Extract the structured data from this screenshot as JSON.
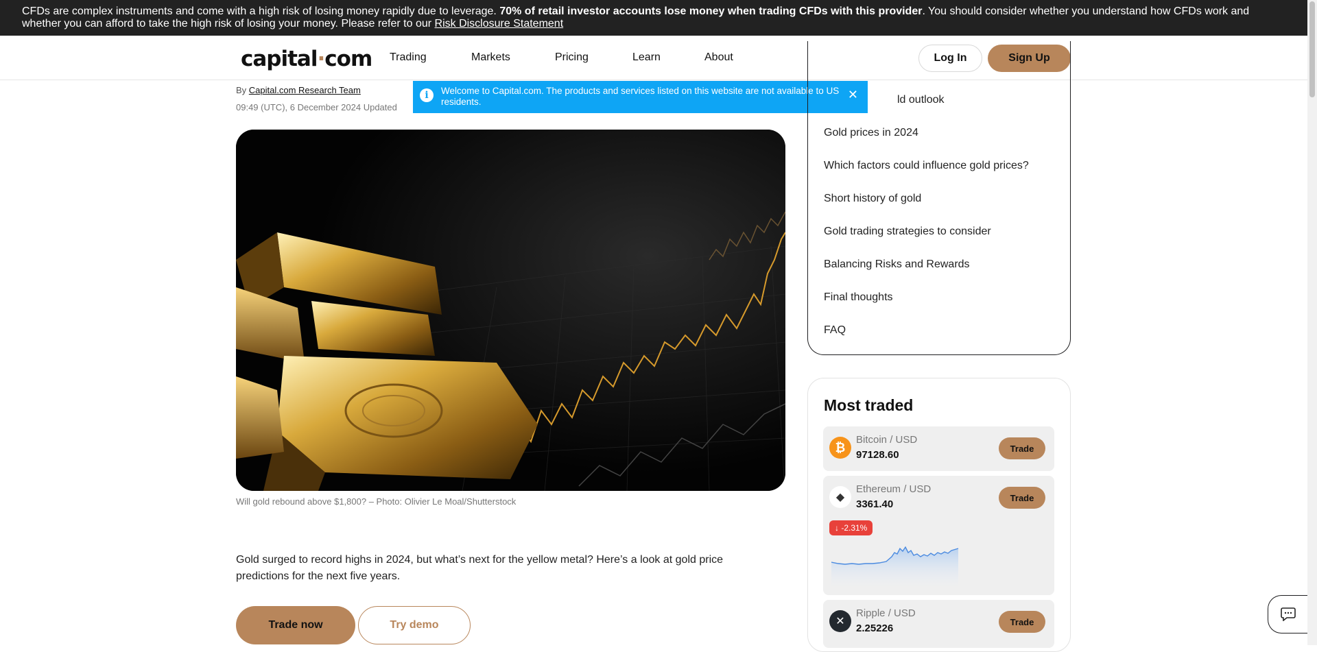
{
  "risk_banner": {
    "text_before": "CFDs are complex instruments and come with a high risk of losing money rapidly due to leverage. ",
    "bold": "70% of retail investor accounts lose money when trading CFDs with this provider",
    "text_after": ". You should consider whether you understand how CFDs work and whether you can afford to take the high risk of losing your money. Please refer to our ",
    "link": "Risk Disclosure Statement"
  },
  "header": {
    "logo_left": "capital",
    "logo_dot": "·",
    "logo_right": "com",
    "nav": [
      "Trading",
      "Markets",
      "Pricing",
      "Learn",
      "About"
    ],
    "login": "Log In",
    "signup": "Sign Up"
  },
  "toast": {
    "icon": "info-icon",
    "text": "Welcome to Capital.com. The products and services listed on this website are not available to US residents.",
    "close": "✕"
  },
  "article": {
    "by": "By ",
    "author": "Capital.com Research Team",
    "date": "09:49 (UTC), 6 December 2024 Updated",
    "caption": "Will gold rebound above $1,800? – Photo: Olivier Le Moal/Shutterstock",
    "intro": "Gold surged to record highs in 2024, but what’s next for the yellow metal? Here’s a look at gold price predictions for the next five years.",
    "trade_now": "Trade now",
    "try_demo": "Try demo"
  },
  "toc": {
    "items": [
      "ld outlook",
      "Gold prices in 2024",
      "Which factors could influence gold prices?",
      "Short history of gold",
      "Gold trading strategies to consider",
      "Balancing Risks and Rewards",
      "Final thoughts",
      "FAQ"
    ]
  },
  "most_traded": {
    "title": "Most traded",
    "trade_label": "Trade",
    "items": [
      {
        "name": "Bitcoin / USD",
        "price": "97128.60",
        "icon": "bitcoin-icon",
        "color": "#f7931a",
        "glyph": "₿"
      },
      {
        "name": "Ethereum / USD",
        "price": "3361.40",
        "icon": "ethereum-icon",
        "color": "#ffffff",
        "glyph": "◆",
        "change": "↓ -2.31%"
      },
      {
        "name": "Ripple / USD",
        "price": "2.25226",
        "icon": "ripple-icon",
        "color": "#23292f",
        "glyph": "✕"
      }
    ]
  },
  "colors": {
    "accent": "#b8865b",
    "info": "#0ea5f5",
    "negative": "#e8413a"
  }
}
